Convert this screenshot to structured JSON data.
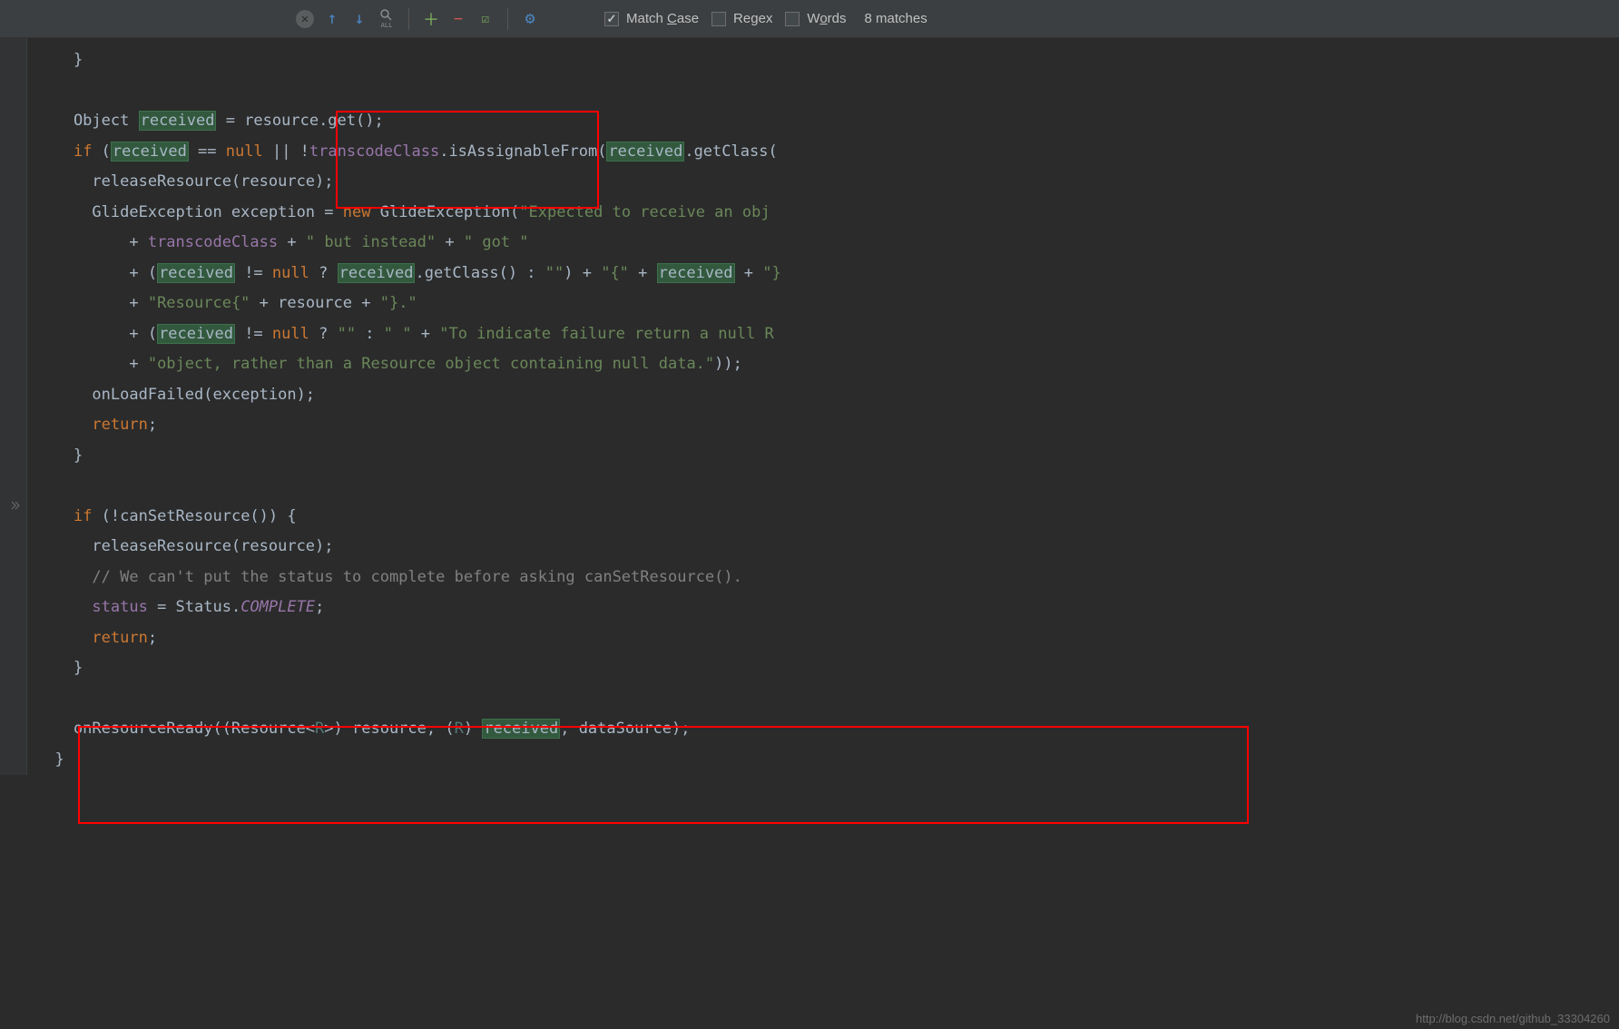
{
  "toolbar": {
    "all_label": "ALL",
    "match_case": "Match Case",
    "regex": "Regex",
    "words": "Words",
    "match_count": "8 matches"
  },
  "code": {
    "brace1": "    }",
    "line_obj_1": "    Object ",
    "received": "received",
    "line_obj_2": " = resource.get();",
    "if1a": "if",
    "if1b": " (",
    "if1c": " == ",
    "null": "null",
    "if1d": " || !",
    "transcodeClass": "transcodeClass",
    "if1e": ".isAssignableFrom(",
    "if1f": ".getClass(",
    "rel_res": "      releaseResource(resource);",
    "ge1": "      GlideException exception = ",
    "new": "new",
    "ge2": " GlideException(",
    "str1": "\"Expected to receive an obj",
    "plus": "          + ",
    "str2": "\" but instead\"",
    "str3": "\" got \"",
    "ne": " != ",
    "q": " ? ",
    "getClass": ".getClass() : ",
    "empty": "\"\"",
    "rparen": ") + ",
    "lbrace_str": "\"{\"",
    "plus2": " + ",
    "rbrace_str": "\"}",
    "lparen": "          + (",
    "str4": "\"Resource{\"",
    "plus3": " + resource + ",
    "str5": "\"}.\"",
    "str6": "\" \"",
    "str7": "\"To indicate failure return a null R",
    "str8": "\"object, rather than a Resource object containing null data.\"",
    "rparen2": "));",
    "onLoadFailed": "      onLoadFailed(exception);",
    "return": "return",
    "semi": ";",
    "brace_close": "    }",
    "if2a": " (!canSetResource()) {",
    "comment": "// We can't put the status to complete before asking canSetResource().",
    "status_field": "status",
    "status_eq": " = Status.",
    "complete": "COMPLETE",
    "onResReady1": "    onResourceReady((Resource<",
    "R": "R",
    "onResReady2": ">) resource, (",
    "onResReady3": ") ",
    "onResReady4": ", dataSource);",
    "brace_close2": "  }"
  },
  "watermark": "http://blog.csdn.net/github_33304260"
}
